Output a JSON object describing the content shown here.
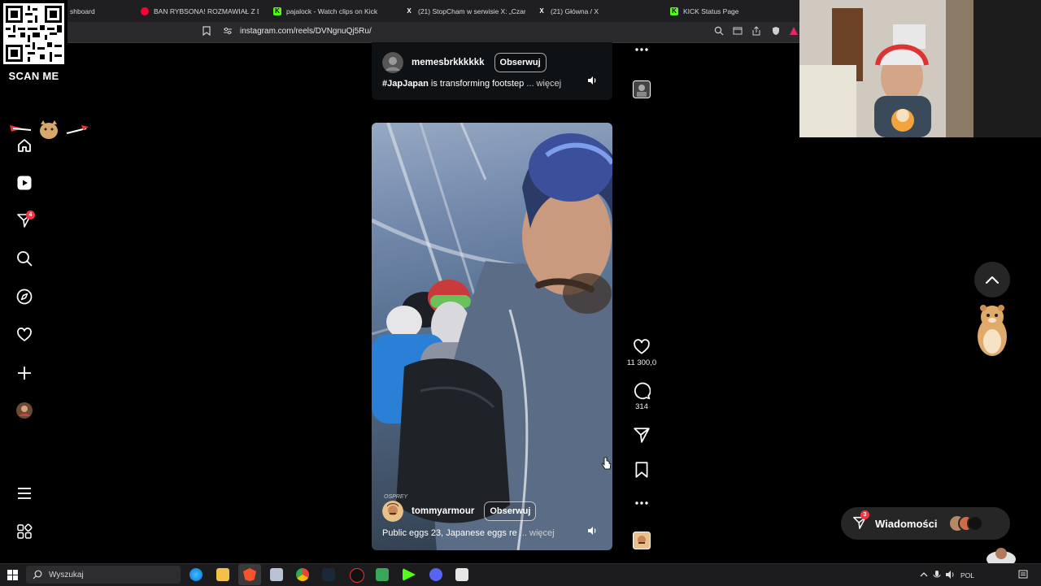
{
  "browser": {
    "tabs": [
      {
        "label": "shboard",
        "favicon": "dashboard-icon",
        "color": "#2b2b2b"
      },
      {
        "label": "BAN RYBSONA! ROZMAWIAŁ Z D**E",
        "favicon": "youtube-icon",
        "color": "#ff0033"
      },
      {
        "label": "pajalock - Watch clips on Kick",
        "favicon": "kick-icon",
        "color": "#53fc18"
      },
      {
        "label": "(21) StopCham w serwisie X: „Czaro",
        "favicon": "x-icon",
        "color": "#ffffff"
      },
      {
        "label": "(21) Główna / X",
        "favicon": "x-icon",
        "color": "#ffffff"
      },
      {
        "label": "KICK Status Page",
        "favicon": "kick-icon",
        "color": "#53fc18"
      }
    ],
    "url": "instagram.com/reels/DVNgnuQj5Ru/"
  },
  "overlay": {
    "scan_label": "SCAN ME"
  },
  "sidebar": {
    "items": [
      {
        "name": "home",
        "icon": "home-icon"
      },
      {
        "name": "reels",
        "icon": "reels-icon"
      },
      {
        "name": "messages",
        "icon": "send-icon",
        "badge": "4"
      },
      {
        "name": "search",
        "icon": "search-icon"
      },
      {
        "name": "explore",
        "icon": "compass-icon"
      },
      {
        "name": "notifications",
        "icon": "heart-icon"
      },
      {
        "name": "create",
        "icon": "plus-icon"
      },
      {
        "name": "profile",
        "icon": "avatar-icon"
      }
    ],
    "more": {
      "icon": "hamburger-icon"
    },
    "apps": {
      "icon": "apps-grid-icon"
    }
  },
  "reel_prev": {
    "username": "memesbrkkkkkk",
    "follow_label": "Obserwuj",
    "caption_hashtag": "#JapJapan",
    "caption_text": " is transforming footstep",
    "more_label": "... więcej"
  },
  "reel_current": {
    "watermark": "OSPREY",
    "username": "tommyarmour",
    "follow_label": "Obserwuj",
    "caption_text": "Public eggs 23, Japanese eggs re",
    "more_label": "... więcej",
    "likes": "11 300,0",
    "comments": "314"
  },
  "right": {
    "messages_label": "Wiadomości",
    "messages_badge": "3"
  },
  "taskbar": {
    "search_placeholder": "Wyszukaj",
    "language": "POL"
  },
  "colors": {
    "accent_red": "#ff3040",
    "background": "#000000"
  }
}
